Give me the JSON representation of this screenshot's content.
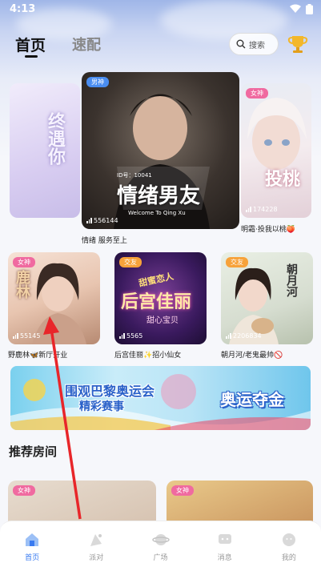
{
  "status_bar": {
    "time": "4:13"
  },
  "header": {
    "tabs": [
      {
        "label": "首页",
        "active": true
      },
      {
        "label": "速配",
        "active": false
      }
    ],
    "search_label": "搜索"
  },
  "carousel": [
    {
      "title_art": "终遇你",
      "count": "",
      "caption": ""
    },
    {
      "badge": "男神",
      "title_art": "情绪男友",
      "subtitle_art": "Welcome To Qing Xu",
      "room_art": "ID号：10041",
      "count": "556144",
      "caption": "情绪 服务至上"
    },
    {
      "badge": "女神",
      "title_art": "投桃",
      "count": "174228",
      "caption": "明霜·投我以桃🍑"
    }
  ],
  "rooms_row": [
    {
      "badge": "女神",
      "title_art": "鹿林",
      "count": "55145",
      "caption": "野鹿林🦋新厅开业"
    },
    {
      "badge": "交友",
      "title_art": "后宫佳丽",
      "tag_art": "甜蜜恋人",
      "sub_art": "甜心宝贝",
      "count": "5565",
      "caption": "后宫佳丽✨招小仙女"
    },
    {
      "badge": "交友",
      "title_art": "朝月河",
      "count": "2206834",
      "caption": "朝月河/老鬼最帅🚫"
    }
  ],
  "banner": {
    "line1": "围观巴黎奥运会",
    "line2": "精彩赛事",
    "line3": "奥运夺金"
  },
  "section_title": "推荐房间",
  "recommended": [
    {
      "badge": "女神"
    },
    {
      "badge": "女神"
    }
  ],
  "bottom_nav": [
    {
      "label": "首页",
      "icon": "home-icon",
      "active": true
    },
    {
      "label": "派对",
      "icon": "party-icon",
      "active": false
    },
    {
      "label": "广场",
      "icon": "planet-icon",
      "active": false
    },
    {
      "label": "消息",
      "icon": "message-icon",
      "active": false
    },
    {
      "label": "我的",
      "icon": "profile-icon",
      "active": false
    }
  ],
  "colors": {
    "accent": "#3a7bf0",
    "male_badge": "#4a8df0",
    "female_badge": "#f06aa0",
    "friend_badge": "#f7a23a"
  }
}
